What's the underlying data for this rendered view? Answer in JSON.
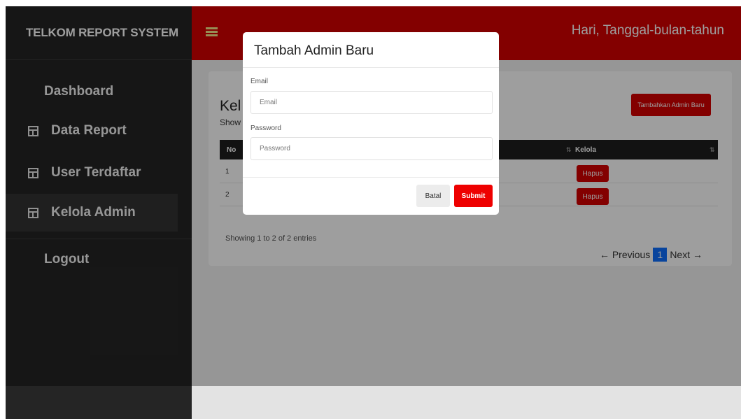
{
  "sidebar": {
    "brand": "TELKOM REPORT SYSTEM",
    "items": [
      {
        "label": "Dashboard"
      },
      {
        "label": "Data Report",
        "icon": "table-icon"
      },
      {
        "label": "User Terdaftar",
        "icon": "table-icon"
      },
      {
        "label": "Kelola Admin",
        "icon": "table-icon",
        "active": true
      },
      {
        "label": "Logout"
      }
    ]
  },
  "header": {
    "menu_icon": "hamburger-icon",
    "date_text": "Hari, Tanggal-bulan-tahun"
  },
  "main": {
    "title_visible": "Kel",
    "show_text": "Show",
    "add_button": "Tambahkan Admin Baru",
    "table": {
      "columns": [
        "No",
        "Kelola"
      ],
      "rows": [
        {
          "no": "1",
          "action": "Hapus"
        },
        {
          "no": "2",
          "action": "Hapus"
        }
      ]
    },
    "entries_info": "Showing 1 to 2 of 2 entries",
    "pagination": {
      "previous": "← Previous",
      "current": "1",
      "next": "Next →"
    }
  },
  "modal": {
    "title": "Tambah Admin Baru",
    "email_label": "Email",
    "email_placeholder": "Email",
    "password_label": "Password",
    "password_placeholder": "Password",
    "cancel": "Batal",
    "submit": "Submit"
  },
  "colors": {
    "header": "#d40000",
    "sidebar": "#252525",
    "submit": "#ee0000",
    "page_active": "#0d6efd"
  }
}
